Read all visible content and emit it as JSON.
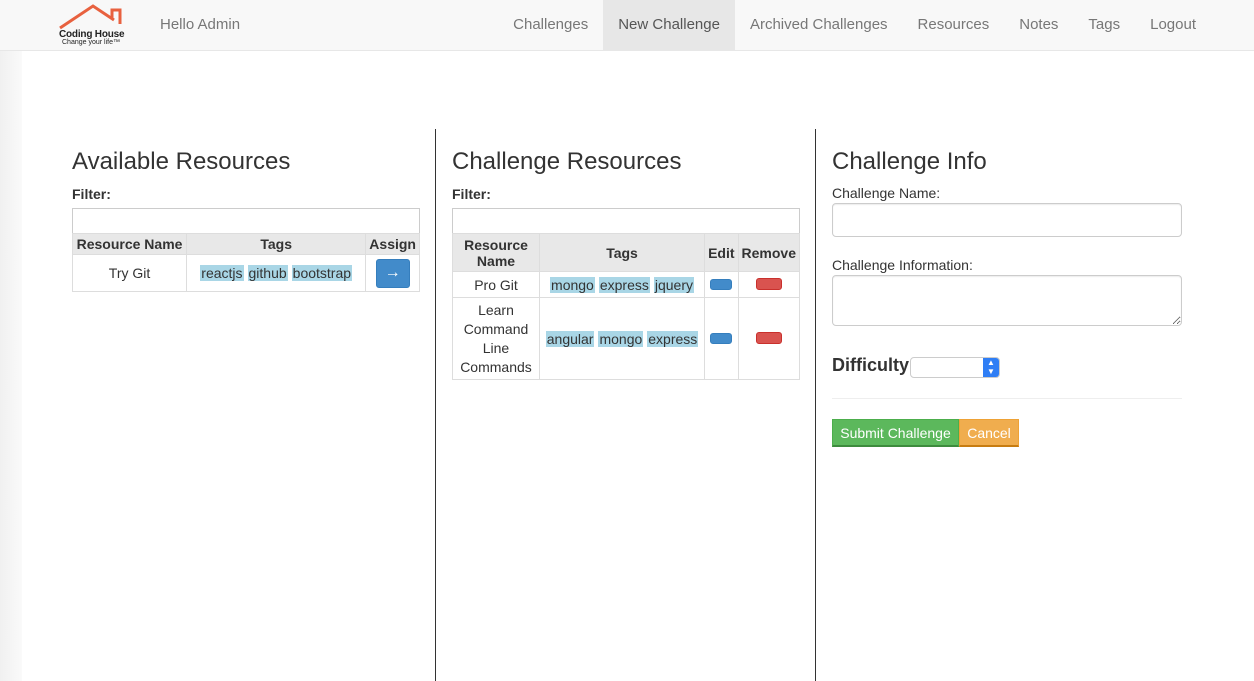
{
  "header": {
    "logo_name": "Coding House",
    "logo_tagline": "Change your life™",
    "greeting": "Hello Admin",
    "nav": [
      {
        "label": "Challenges"
      },
      {
        "label": "New Challenge",
        "active": true
      },
      {
        "label": "Archived Challenges"
      },
      {
        "label": "Resources"
      },
      {
        "label": "Notes"
      },
      {
        "label": "Tags"
      },
      {
        "label": "Logout"
      }
    ]
  },
  "available": {
    "title": "Available Resources",
    "filter_label": "Filter:",
    "filter_value": "",
    "columns": [
      "Resource Name",
      "Tags",
      "Assign"
    ],
    "rows": [
      {
        "name": "Try Git",
        "tags": [
          "reactjs",
          "github",
          "bootstrap"
        ],
        "assign": "→"
      }
    ]
  },
  "challenge_resources": {
    "title": "Challenge Resources",
    "filter_label": "Filter:",
    "filter_value": "",
    "columns": [
      "Resource Name",
      "Tags",
      "Edit",
      "Remove"
    ],
    "rows": [
      {
        "name": "Pro Git",
        "tags": [
          "mongo",
          "express",
          "jquery"
        ]
      },
      {
        "name": "Learn Command Line Commands",
        "tags": [
          "angular",
          "mongo",
          "express"
        ]
      }
    ]
  },
  "info": {
    "title": "Challenge Info",
    "name_label": "Challenge Name:",
    "name_value": "",
    "information_label": "Challenge Information:",
    "information_value": "",
    "difficulty_label": "Difficulty:",
    "difficulty_value": "",
    "submit_label": "Submit Challenge",
    "cancel_label": "Cancel"
  },
  "colors": {
    "primary": "#428bca",
    "danger": "#d9534f",
    "success": "#5cb85c",
    "warning": "#f0ad4e",
    "tag": "#a9d6e6",
    "logo": "#e8613f"
  }
}
